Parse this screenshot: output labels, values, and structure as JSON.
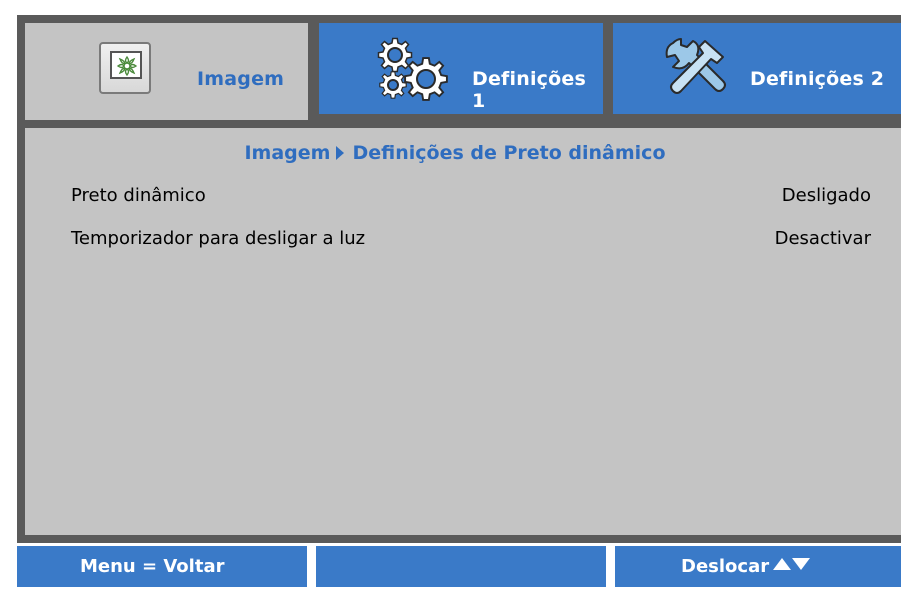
{
  "tabs": [
    {
      "label": "Imagem",
      "icon": "picture-icon",
      "active": true
    },
    {
      "label": "Definições 1",
      "icon": "gears-icon",
      "active": false
    },
    {
      "label": "Definições 2",
      "icon": "tools-icon",
      "active": false
    }
  ],
  "breadcrumb": {
    "parent": "Imagem",
    "current": "Definições de Preto dinâmico"
  },
  "settings": [
    {
      "label": "Preto dinâmico",
      "value": "Desligado"
    },
    {
      "label": "Temporizador para desligar a luz",
      "value": "Desactivar"
    }
  ],
  "footer": {
    "left": "Menu = Voltar",
    "middle": "",
    "right": "Deslocar"
  },
  "colors": {
    "panel_bg": "#c4c4c4",
    "frame": "#5a5a5a",
    "accent_blue": "#3a7ac8",
    "active_text": "#2f6dbf"
  }
}
